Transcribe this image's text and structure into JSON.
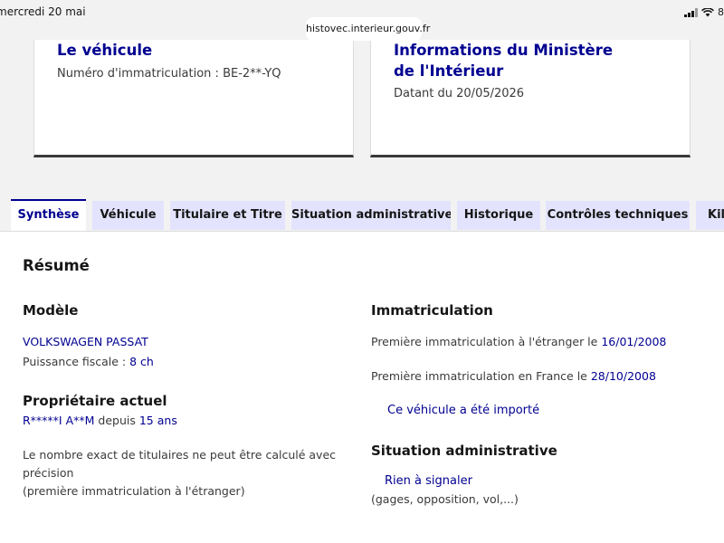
{
  "status_bar": {
    "date": "mercredi 20 mai",
    "url": "histovec.interieur.gouv.fr",
    "battery": "8"
  },
  "card_vehicle": {
    "title": "Le véhicule",
    "plate_label": "Numéro d'immatriculation : ",
    "plate": "BE-2**-YQ"
  },
  "card_ministry": {
    "title": "Informations du Ministère de l'Intérieur",
    "date_label": "Datant du ",
    "date": "20/05/2026"
  },
  "tabs": [
    {
      "label": "Synthèse"
    },
    {
      "label": "Véhicule"
    },
    {
      "label": "Titulaire et Titre"
    },
    {
      "label": "Situation administrative"
    },
    {
      "label": "Historique"
    },
    {
      "label": "Contrôles techniques"
    },
    {
      "label": "Kilo"
    }
  ],
  "resume": {
    "title": "Résumé",
    "model": {
      "heading": "Modèle",
      "name": "VOLKSWAGEN PASSAT",
      "power_label": "Puissance fiscale : ",
      "power": "8 ch"
    },
    "owner": {
      "heading": "Propriétaire actuel",
      "name": "R*****I A**M",
      "since_label": " depuis ",
      "since": "15 ans",
      "note_line1": "Le nombre exact de titulaires ne peut être calculé avec",
      "note_line2": "précision",
      "note_line3": "(première immatriculation à l'étranger)"
    },
    "registration": {
      "heading": "Immatriculation",
      "foreign_label": "Première immatriculation à l'étranger le ",
      "foreign_date": "16/01/2008",
      "france_label": "Première immatriculation en France le ",
      "france_date": "28/10/2008",
      "imported": "Ce véhicule a été importé"
    },
    "admin": {
      "heading": "Situation administrative",
      "status": "Rien à signaler",
      "detail": "(gages, opposition, vol,...)"
    }
  }
}
